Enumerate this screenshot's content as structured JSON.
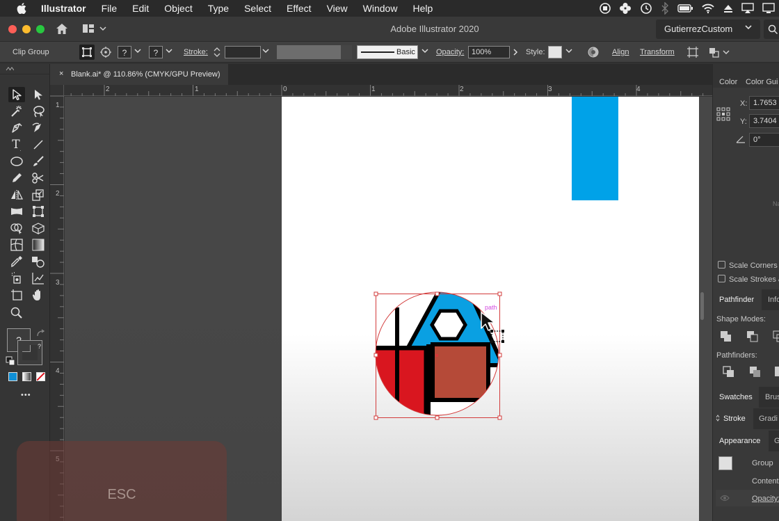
{
  "menubar": {
    "app": "Illustrator",
    "items": [
      "File",
      "Edit",
      "Object",
      "Type",
      "Select",
      "Effect",
      "View",
      "Window",
      "Help"
    ]
  },
  "titlebar": {
    "title": "Adobe Illustrator 2020",
    "workspace": "GutierrezCustom"
  },
  "controlbar": {
    "selection_type": "Clip Group",
    "stroke_label": "Stroke:",
    "brush_label": "Basic",
    "opacity_label": "Opacity:",
    "opacity_value": "100%",
    "style_label": "Style:",
    "align_label": "Align",
    "transform_label": "Transform",
    "unknown_symbol": "?"
  },
  "document_tab": {
    "close": "×",
    "title": "Blank.ai* @ 110.86% (CMYK/GPU Preview)"
  },
  "rulers": {
    "horizontal": [
      "2",
      "1",
      "0",
      "1",
      "2",
      "3",
      "4"
    ],
    "vertical": [
      "1",
      "2",
      "3",
      "4",
      "5"
    ]
  },
  "toolbar": {
    "fill_stroke_symbol": "?",
    "more_tools": "•••"
  },
  "canvas": {
    "smart_guide_label": "path",
    "colors": {
      "blue": "#00a2e8",
      "red": "#d9161f",
      "brown": "#b54a38",
      "selection": "#d23a3a"
    }
  },
  "keystroke_overlay": "ESC",
  "panels": {
    "color_tab": "Color",
    "color_guide_tab": "Color Gui",
    "x_label": "X:",
    "x_value": "1.7653",
    "y_label": "Y:",
    "y_value": "3.7404",
    "angle_value": "0°",
    "truncated_label": "Na",
    "scale_corners": "Scale Corners",
    "scale_strokes": "Scale Strokes &",
    "pathfinder_tab": "Pathfinder",
    "info_tab": "Info",
    "shape_modes": "Shape Modes:",
    "pathfinders": "Pathfinders:",
    "swatches_tab": "Swatches",
    "brushes_tab": "Brus",
    "stroke_tab": "Stroke",
    "gradient_tab": "Gradi",
    "appearance_tab": "Appearance",
    "graphic_styles_tab": "G",
    "group_label": "Group",
    "contents_label": "Content",
    "opacity_label": "Opacity:"
  }
}
